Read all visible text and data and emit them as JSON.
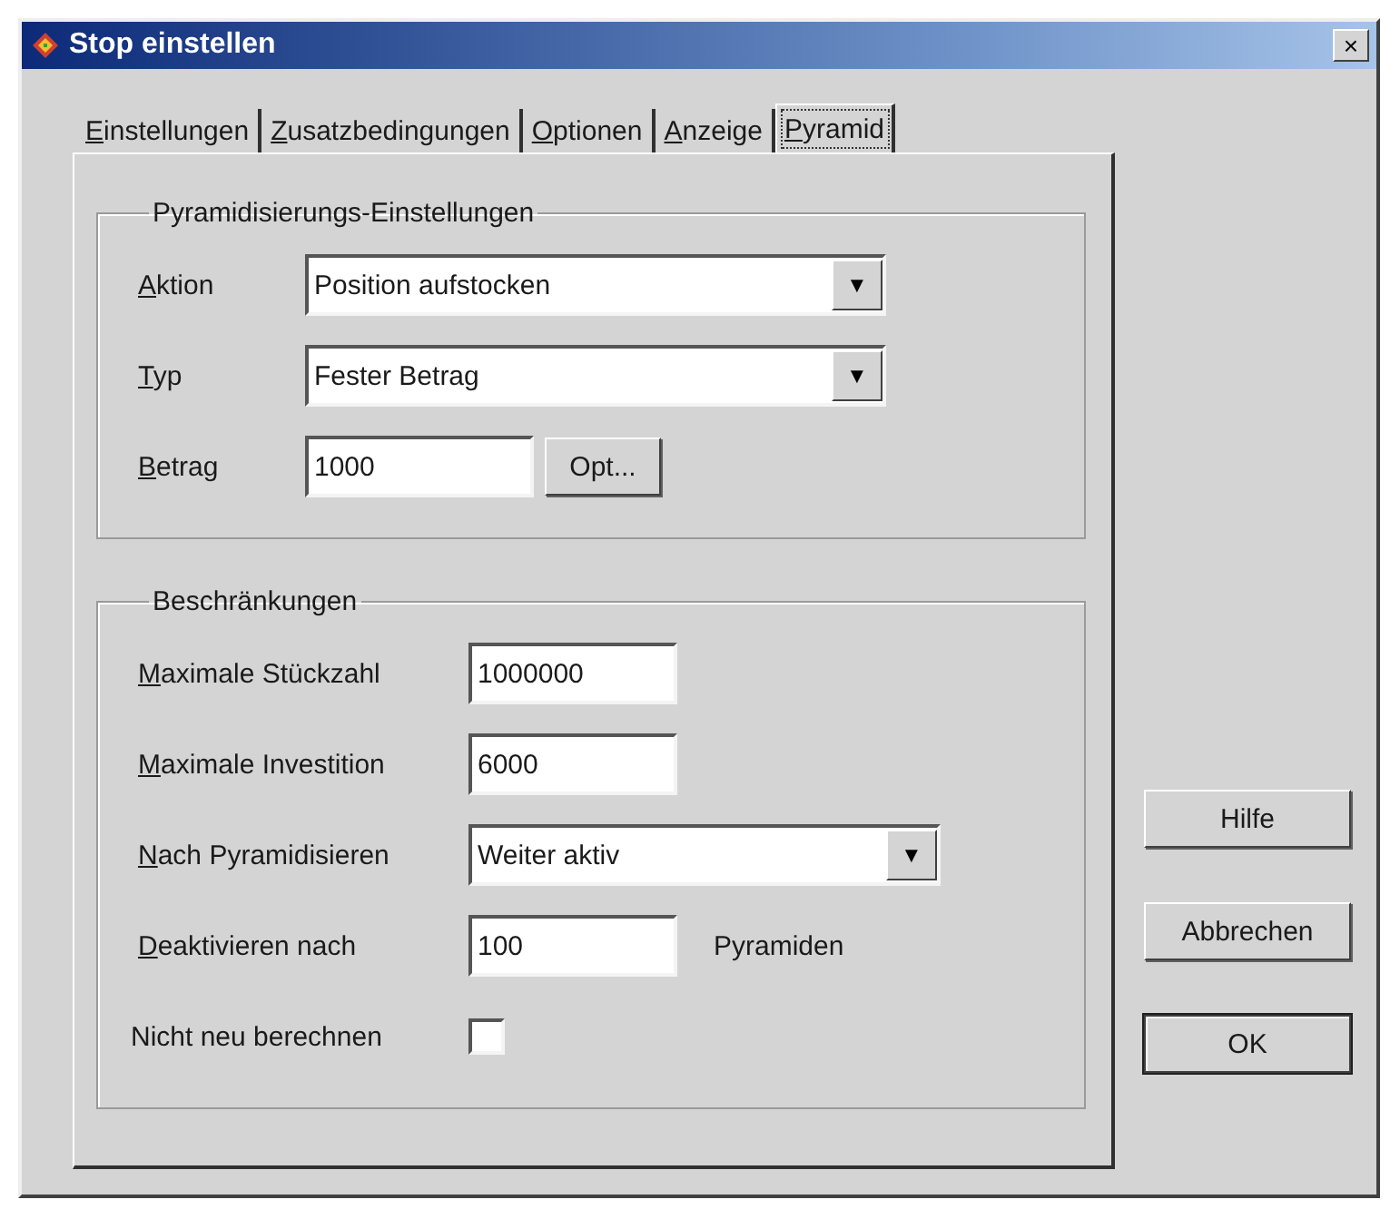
{
  "window": {
    "title": "Stop einstellen",
    "close": "×"
  },
  "tabs": [
    {
      "label": "Einstellungen",
      "mnemonic": true,
      "selected": false
    },
    {
      "label": "Zusatzbedingungen",
      "mnemonic": true,
      "selected": false
    },
    {
      "label": "Optionen",
      "mnemonic": true,
      "selected": false
    },
    {
      "label": "Anzeige",
      "mnemonic": true,
      "selected": false
    },
    {
      "label": "Pyramid",
      "mnemonic": true,
      "selected": true
    }
  ],
  "groups": [
    {
      "title": "Pyramidisierungs-Einstellungen",
      "rows": [
        {
          "kind": "dropdown",
          "label": "Aktion",
          "mnemonic": true,
          "value": "Position aufstocken",
          "arrow": "▼"
        },
        {
          "kind": "dropdown",
          "label": "Typ",
          "mnemonic": true,
          "value": "Fester Betrag",
          "arrow": "▼"
        },
        {
          "kind": "text_button",
          "label": "Betrag",
          "mnemonic": true,
          "value": "1000",
          "button": "Opt..."
        }
      ]
    },
    {
      "title": "Beschränkungen",
      "rows": [
        {
          "kind": "text",
          "label": "Maximale Stückzahl",
          "mnemonic": true,
          "value": "1000000"
        },
        {
          "kind": "text",
          "label": "Maximale Investition",
          "mnemonic": true,
          "value": "6000"
        },
        {
          "kind": "dropdown",
          "label": "Nach Pyramidisieren",
          "mnemonic": true,
          "value": "Weiter aktiv",
          "arrow": "▼"
        },
        {
          "kind": "text_suffix",
          "label": "Deaktivieren nach",
          "mnemonic": true,
          "value": "100",
          "suffix": "Pyramiden"
        },
        {
          "kind": "checkbox",
          "label": "Nicht neu berechnen",
          "mnemonic": false,
          "checked": false
        }
      ]
    }
  ],
  "buttons": [
    {
      "label": "Hilfe",
      "default": false
    },
    {
      "label": "Abbrechen",
      "default": false
    },
    {
      "label": "OK",
      "default": true
    }
  ]
}
